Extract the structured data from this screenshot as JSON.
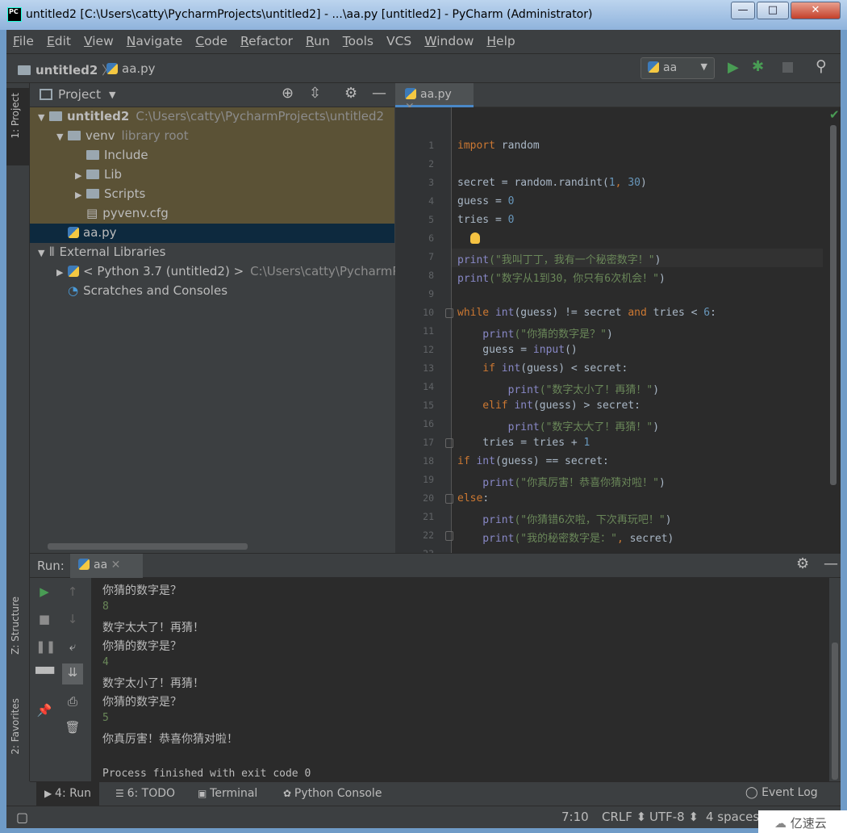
{
  "window": {
    "title": "untitled2 [C:\\Users\\catty\\PycharmProjects\\untitled2] - ...\\aa.py [untitled2] - PyCharm (Administrator)",
    "icon": "PC",
    "minimize": "—",
    "maximize": "□",
    "close": "✕"
  },
  "menu": [
    {
      "u": "F",
      "r": "ile"
    },
    {
      "u": "E",
      "r": "dit"
    },
    {
      "u": "V",
      "r": "iew"
    },
    {
      "u": "N",
      "r": "avigate"
    },
    {
      "u": "C",
      "r": "ode"
    },
    {
      "u": "R",
      "r": "efactor"
    },
    {
      "u": "R",
      "r": "un"
    },
    {
      "u": "T",
      "r": "ools"
    },
    {
      "u": "",
      "r": "VCS"
    },
    {
      "u": "W",
      "r": "indow"
    },
    {
      "u": "H",
      "r": "elp"
    }
  ],
  "breadcrumb": {
    "project": "untitled2",
    "file": "aa.py"
  },
  "run_config": {
    "name": "aa"
  },
  "left_tabs": {
    "project": "1: Project",
    "structure": "Z: Structure",
    "favorites": "2: Favorites"
  },
  "project_panel": {
    "title": "Project",
    "tree": [
      {
        "arrow": "▼",
        "indent": 0,
        "icon": "folder",
        "label": "untitled2",
        "extra": "C:\\Users\\catty\\PycharmProjects\\untitled2",
        "bold": true,
        "state": "hl"
      },
      {
        "arrow": "▼",
        "indent": 1,
        "icon": "folder",
        "label": "venv",
        "extra": "library root",
        "state": "hl"
      },
      {
        "arrow": "",
        "indent": 2,
        "icon": "folder",
        "label": "Include",
        "extra": "",
        "state": "hl"
      },
      {
        "arrow": "▶",
        "indent": 2,
        "icon": "folder",
        "label": "Lib",
        "extra": "",
        "state": "hl"
      },
      {
        "arrow": "▶",
        "indent": 2,
        "icon": "folder",
        "label": "Scripts",
        "extra": "",
        "state": "hl"
      },
      {
        "arrow": "",
        "indent": 2,
        "icon": "file",
        "label": "pyvenv.cfg",
        "extra": "",
        "state": "hl"
      },
      {
        "arrow": "",
        "indent": 1,
        "icon": "python",
        "label": "aa.py",
        "extra": "",
        "state": "sel"
      },
      {
        "arrow": "▼",
        "indent": 0,
        "icon": "library",
        "label": "External Libraries",
        "extra": "",
        "state": ""
      },
      {
        "arrow": "▶",
        "indent": 1,
        "icon": "python",
        "label": "< Python 3.7 (untitled2) >",
        "extra": "C:\\Users\\catty\\PycharmPr",
        "state": ""
      },
      {
        "arrow": "",
        "indent": 1,
        "icon": "scratch",
        "label": "Scratches and Consoles",
        "extra": "",
        "state": ""
      }
    ]
  },
  "editor": {
    "tab": "aa.py",
    "current_line": 7,
    "lines": [
      [
        [
          "import",
          "kw"
        ],
        [
          " random",
          "tx"
        ]
      ],
      [],
      [
        [
          "secret = random.randint(",
          "tx"
        ],
        [
          "1",
          "nu"
        ],
        [
          ", ",
          "kw"
        ],
        [
          "30",
          "nu"
        ],
        [
          ")",
          "tx"
        ]
      ],
      [
        [
          "guess = ",
          "tx"
        ],
        [
          "0",
          "nu"
        ]
      ],
      [
        [
          "tries = ",
          "tx"
        ],
        [
          "0",
          "nu"
        ]
      ],
      [],
      [
        [
          "print",
          "bi"
        ],
        [
          "(\"我叫丁丁，我有一个秘密数字！\"",
          "st"
        ],
        [
          ")",
          "tx"
        ]
      ],
      [
        [
          "print",
          "bi"
        ],
        [
          "(\"数字从1到30，你只有6次机会！\"",
          "st"
        ],
        [
          ")",
          "tx"
        ]
      ],
      [],
      [
        [
          "while ",
          "kw"
        ],
        [
          "int",
          "bi"
        ],
        [
          "(guess) != secret ",
          "tx"
        ],
        [
          "and",
          "kw"
        ],
        [
          " tries < ",
          "tx"
        ],
        [
          "6",
          "nu"
        ],
        [
          ":",
          "tx"
        ]
      ],
      [
        [
          "    print",
          "bi"
        ],
        [
          "(\"你猜的数字是？\"",
          "st"
        ],
        [
          ")",
          "tx"
        ]
      ],
      [
        [
          "    guess = ",
          "tx"
        ],
        [
          "input",
          "bi"
        ],
        [
          "()",
          "tx"
        ]
      ],
      [
        [
          "    if ",
          "kw"
        ],
        [
          "int",
          "bi"
        ],
        [
          "(guess) < secret:",
          "tx"
        ]
      ],
      [
        [
          "        print",
          "bi"
        ],
        [
          "(\"数字太小了！再猜！\"",
          "st"
        ],
        [
          ")",
          "tx"
        ]
      ],
      [
        [
          "    elif ",
          "kw"
        ],
        [
          "int",
          "bi"
        ],
        [
          "(guess) > secret:",
          "tx"
        ]
      ],
      [
        [
          "        print",
          "bi"
        ],
        [
          "(\"数字太大了！再猜！\"",
          "st"
        ],
        [
          ")",
          "tx"
        ]
      ],
      [
        [
          "    tries = tries + ",
          "tx"
        ],
        [
          "1",
          "nu"
        ]
      ],
      [
        [
          "if ",
          "kw"
        ],
        [
          "int",
          "bi"
        ],
        [
          "(guess) == secret:",
          "tx"
        ]
      ],
      [
        [
          "    print",
          "bi"
        ],
        [
          "(\"你真厉害！恭喜你猜对啦！\"",
          "st"
        ],
        [
          ")",
          "tx"
        ]
      ],
      [
        [
          "else",
          "kw"
        ],
        [
          ":",
          "tx"
        ]
      ],
      [
        [
          "    print",
          "bi"
        ],
        [
          "(\"你猜错6次啦，下次再玩吧！\"",
          "st"
        ],
        [
          ")",
          "tx"
        ]
      ],
      [
        [
          "    print",
          "bi"
        ],
        [
          "(\"我的秘密数字是：\"",
          "st"
        ],
        [
          ", ",
          "kw"
        ],
        [
          "secret)",
          "tx"
        ]
      ],
      []
    ]
  },
  "run_panel": {
    "label": "Run:",
    "tab": "aa",
    "output": [
      {
        "text": "你猜的数字是？",
        "type": "out"
      },
      {
        "text": "8",
        "type": "in"
      },
      {
        "text": "数字太大了！再猜！",
        "type": "out"
      },
      {
        "text": "你猜的数字是？",
        "type": "out"
      },
      {
        "text": "4",
        "type": "in"
      },
      {
        "text": "数字太小了！再猜！",
        "type": "out"
      },
      {
        "text": "你猜的数字是？",
        "type": "out"
      },
      {
        "text": "5",
        "type": "in"
      },
      {
        "text": "你真厉害！恭喜你猜对啦！",
        "type": "out"
      },
      {
        "text": "",
        "type": "out"
      },
      {
        "text": "Process finished with exit code 0",
        "type": "mono"
      }
    ]
  },
  "bottom_tabs": [
    {
      "label": "4: Run",
      "icon": "run-icon"
    },
    {
      "label": "6: TODO",
      "icon": "todo-icon"
    },
    {
      "label": "Terminal",
      "icon": "terminal-icon"
    },
    {
      "label": "Python Console",
      "icon": "python-console-icon"
    }
  ],
  "event_log": "Event Log",
  "status": {
    "position": "7:10",
    "line_sep": "CRLF ⬍",
    "encoding": "UTF-8 ⬍",
    "indent": "4 spaces ⬍"
  },
  "watermark": "亿速云",
  "colors": {
    "keyword": "#cc7832",
    "builtin": "#8888c6",
    "string": "#6a8759",
    "number": "#6897bb",
    "selection": "#0d293e",
    "run_green": "#499c54"
  }
}
